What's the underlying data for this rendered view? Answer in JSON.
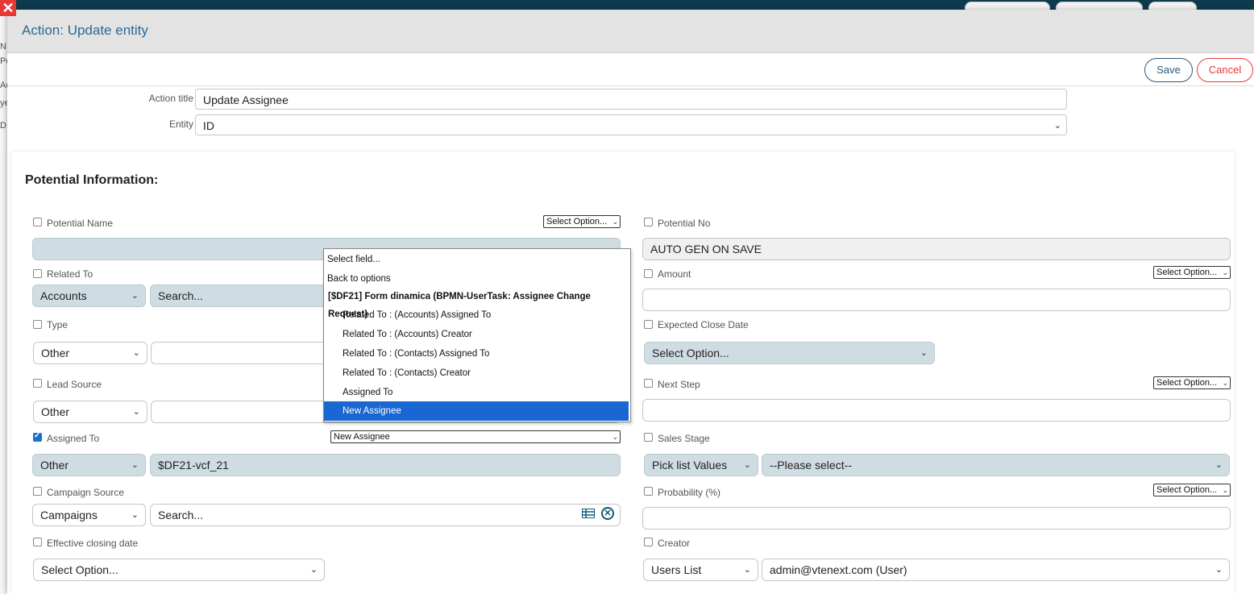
{
  "modal": {
    "title": "Action: Update entity",
    "save_label": "Save",
    "cancel_label": "Cancel"
  },
  "form": {
    "action_title_label": "Action title",
    "action_title_value": "Update Assignee",
    "entity_label": "Entity",
    "entity_value": "ID"
  },
  "section": {
    "title": "Potential Information:"
  },
  "fields": {
    "potential_name": {
      "label": "Potential Name",
      "mini": "Select Option..."
    },
    "potential_no": {
      "label": "Potential No",
      "value": "AUTO GEN ON SAVE"
    },
    "related_to": {
      "label": "Related To",
      "type": "Accounts",
      "search": "Search..."
    },
    "amount": {
      "label": "Amount",
      "mini": "Select Option..."
    },
    "type": {
      "label": "Type",
      "type": "Other"
    },
    "expected_close_date": {
      "label": "Expected Close Date",
      "value": "Select Option..."
    },
    "lead_source": {
      "label": "Lead Source",
      "type": "Other"
    },
    "next_step": {
      "label": "Next Step",
      "mini": "Select Option..."
    },
    "assigned_to": {
      "label": "Assigned To",
      "type": "Other",
      "value": "$DF21-vcf_21",
      "mini": "New Assignee"
    },
    "sales_stage": {
      "label": "Sales Stage",
      "type": "Pick list Values",
      "value": "--Please select--"
    },
    "campaign_source": {
      "label": "Campaign Source",
      "type": "Campaigns",
      "search": "Search..."
    },
    "probability": {
      "label": "Probability (%)",
      "mini": "Select Option..."
    },
    "effective_closing_date": {
      "label": "Effective closing date",
      "value": "Select Option..."
    },
    "creator": {
      "label": "Creator",
      "type": "Users List",
      "value": "admin@vtenext.com (User)"
    }
  },
  "dropdown": {
    "select_field": "Select field...",
    "back": "Back to options",
    "group": "[$DF21] Form dinamica (BPMN-UserTask: Assignee Change Request)",
    "options": [
      "Related To : (Accounts) Assigned To",
      "Related To : (Accounts) Creator",
      "Related To : (Contacts) Assigned To",
      "Related To : (Contacts) Creator",
      "Assigned To",
      "New Assignee"
    ],
    "selected_index": 5
  },
  "background": {
    "left_letters": [
      "N",
      "Po",
      "Ac",
      "ye",
      "D"
    ]
  },
  "icons": {
    "close": "close-icon",
    "list": "list-icon",
    "clear": "clear-circle-icon",
    "arrow": "chevron-down-icon"
  }
}
